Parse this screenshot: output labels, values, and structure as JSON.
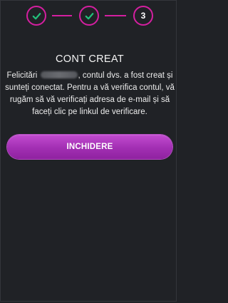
{
  "stepper": {
    "steps": [
      {
        "state": "completed",
        "icon": "checkmark-icon"
      },
      {
        "state": "completed",
        "icon": "checkmark-icon"
      },
      {
        "state": "current",
        "label": "3"
      }
    ],
    "accent_color": "#d41fa0",
    "check_color": "#22c07a"
  },
  "content": {
    "title": "CONT CREAT",
    "message_prefix": "Felicitări",
    "message_suffix": ", contul dvs. a fost creat și sunteți conectat. Pentru a vă verifica contul, vă rugăm să vă verificați adresa de e-mail și să faceți clic pe linkul de verificare."
  },
  "actions": {
    "close_label": "INCHIDERE"
  }
}
